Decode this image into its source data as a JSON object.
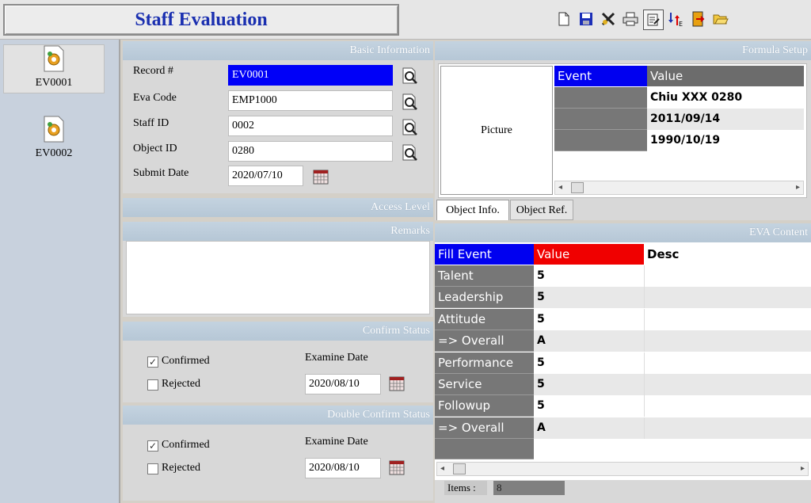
{
  "app": {
    "title": "Staff Evaluation"
  },
  "toolbar": {
    "icons": [
      "new-document-icon",
      "save-icon",
      "delete-icon",
      "print-icon",
      "edit-icon",
      "transfer-icon",
      "exit-icon",
      "open-folder-icon"
    ],
    "active_icon": "edit-icon"
  },
  "records": [
    {
      "label": "EV0001",
      "selected": true
    },
    {
      "label": "EV0002",
      "selected": false
    }
  ],
  "basic_info": {
    "heading": "Basic Information",
    "record_label": "Record #",
    "record_value": "EV0001",
    "eva_code_label": "Eva Code",
    "eva_code_value": "EMP1000",
    "staff_id_label": "Staff ID",
    "staff_id_value": "0002",
    "object_id_label": "Object ID",
    "object_id_value": "0280",
    "submit_date_label": "Submit Date",
    "submit_date_value": "2020/07/10"
  },
  "access_level": {
    "heading": "Access Level"
  },
  "remarks": {
    "heading": "Remarks",
    "value": ""
  },
  "confirm_status": {
    "heading": "Confirm Status",
    "confirmed_label": "Confirmed",
    "confirmed_checked": true,
    "rejected_label": "Rejected",
    "rejected_checked": false,
    "examine_date_label": "Examine Date",
    "examine_date_value": "2020/08/10"
  },
  "double_confirm_status": {
    "heading": "Double Confirm Status",
    "confirmed_label": "Confirmed",
    "confirmed_checked": true,
    "rejected_label": "Rejected",
    "rejected_checked": false,
    "examine_date_label": "Examine Date",
    "examine_date_value": "2020/08/10"
  },
  "formula_setup": {
    "heading": "Formula Setup",
    "picture_label": "Picture",
    "columns": [
      "Event",
      "Value"
    ],
    "rows": [
      {
        "event": "",
        "value": "Chiu XXX 0280"
      },
      {
        "event": "",
        "value": "2011/09/14"
      },
      {
        "event": "",
        "value": "1990/10/19"
      }
    ],
    "tabs": [
      "Object Info.",
      "Object Ref."
    ],
    "active_tab": "Object Info."
  },
  "eva_content": {
    "heading": "EVA Content",
    "columns": [
      "Fill Event",
      "Value",
      "Desc"
    ],
    "rows": [
      {
        "event": "Talent",
        "value": "5",
        "desc": ""
      },
      {
        "event": "Leadership",
        "value": "5",
        "desc": ""
      },
      {
        "event": "Attitude",
        "value": "5",
        "desc": ""
      },
      {
        "event": "=> Overall",
        "value": "A",
        "desc": ""
      },
      {
        "event": "Performance",
        "value": "5",
        "desc": ""
      },
      {
        "event": "Service",
        "value": "5",
        "desc": ""
      },
      {
        "event": "Followup",
        "value": "5",
        "desc": ""
      },
      {
        "event": "=> Overall",
        "value": "A",
        "desc": ""
      }
    ],
    "items_label": "Items :",
    "items_count": "8"
  },
  "colors": {
    "accent_title": "#1a2fb0",
    "selection_blue": "#0000f8",
    "header_red": "#f00000",
    "panel_head": "#b6c7d6"
  }
}
